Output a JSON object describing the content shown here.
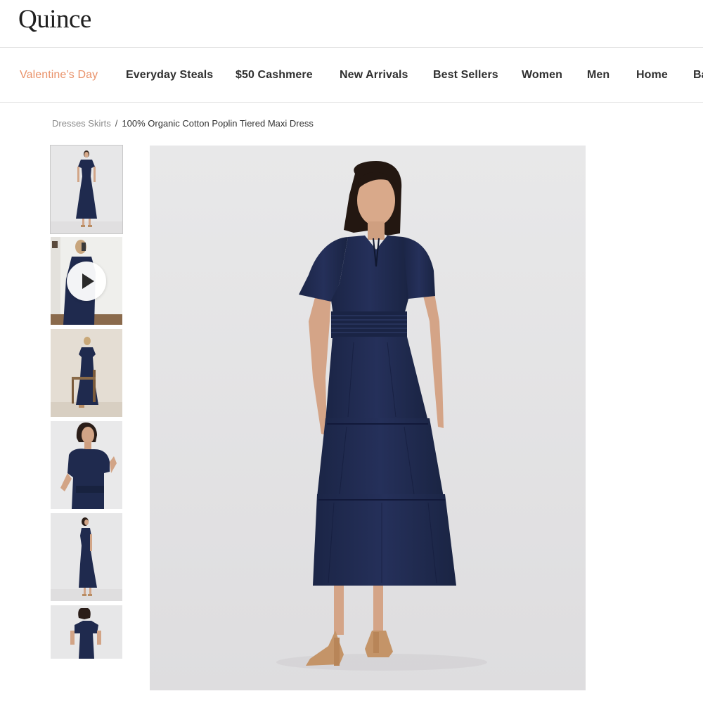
{
  "brand": {
    "logo_text": "Quince"
  },
  "nav": {
    "items": [
      {
        "label": "Valentine’s Day",
        "accent": true
      },
      {
        "label": "Everyday Steals"
      },
      {
        "label": "$50 Cashmere"
      },
      {
        "label": "New Arrivals"
      },
      {
        "label": "Best Sellers"
      },
      {
        "label": "Women"
      },
      {
        "label": "Men"
      },
      {
        "label": "Home"
      },
      {
        "label": "Ba"
      }
    ],
    "accent_color": "#e9926a"
  },
  "breadcrumb": {
    "parent": "Dresses Skirts",
    "separator": "/",
    "current": "100% Organic Cotton Poplin Tiered Maxi Dress"
  },
  "gallery": {
    "thumbnail_count": 6,
    "selected_index": 0,
    "video_thumbnail_index": 1,
    "product_color": "#1f2a4e"
  },
  "icons": {
    "play": "play-icon"
  }
}
